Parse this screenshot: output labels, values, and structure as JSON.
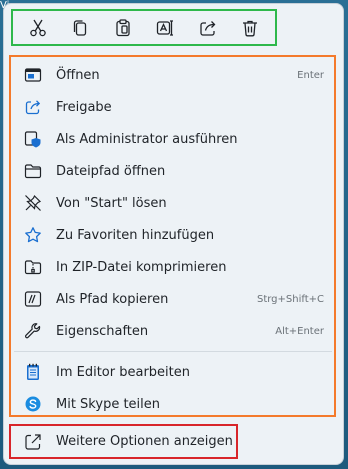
{
  "background_label": "Vi",
  "colors": {
    "accent": "#1a6fd0",
    "top_group_border": "#2eb84b",
    "items_group_border": "#f47a2b",
    "more_group_border": "#d8252a",
    "menu_bg": "#edf2f6"
  },
  "top_actions": [
    {
      "name": "cut",
      "icon": "scissors-icon"
    },
    {
      "name": "copy",
      "icon": "copy-icon"
    },
    {
      "name": "paste",
      "icon": "clipboard-icon"
    },
    {
      "name": "rename",
      "icon": "rename-icon"
    },
    {
      "name": "share",
      "icon": "share-icon"
    },
    {
      "name": "delete",
      "icon": "trash-icon"
    }
  ],
  "menu": {
    "items": [
      {
        "label": "Öffnen",
        "shortcut": "Enter",
        "icon": "open-window-icon"
      },
      {
        "label": "Freigabe",
        "shortcut": "",
        "icon": "share-icon"
      },
      {
        "label": "Als Administrator ausführen",
        "shortcut": "",
        "icon": "admin-shield-icon"
      },
      {
        "label": "Dateipfad öffnen",
        "shortcut": "",
        "icon": "folder-icon"
      },
      {
        "label": "Von \"Start\" lösen",
        "shortcut": "",
        "icon": "unpin-icon"
      },
      {
        "label": "Zu Favoriten hinzufügen",
        "shortcut": "",
        "icon": "star-icon"
      },
      {
        "label": "In ZIP-Datei komprimieren",
        "shortcut": "",
        "icon": "zip-folder-icon"
      },
      {
        "label": "Als Pfad kopieren",
        "shortcut": "Strg+Shift+C",
        "icon": "copy-path-icon"
      },
      {
        "label": "Eigenschaften",
        "shortcut": "Alt+Enter",
        "icon": "wrench-icon"
      },
      {
        "label": "Im Editor bearbeiten",
        "shortcut": "",
        "icon": "notepad-icon"
      },
      {
        "label": "Mit Skype teilen",
        "shortcut": "",
        "icon": "skype-icon"
      }
    ],
    "more_options": {
      "label": "Weitere Optionen anzeigen",
      "icon": "more-options-icon"
    }
  }
}
